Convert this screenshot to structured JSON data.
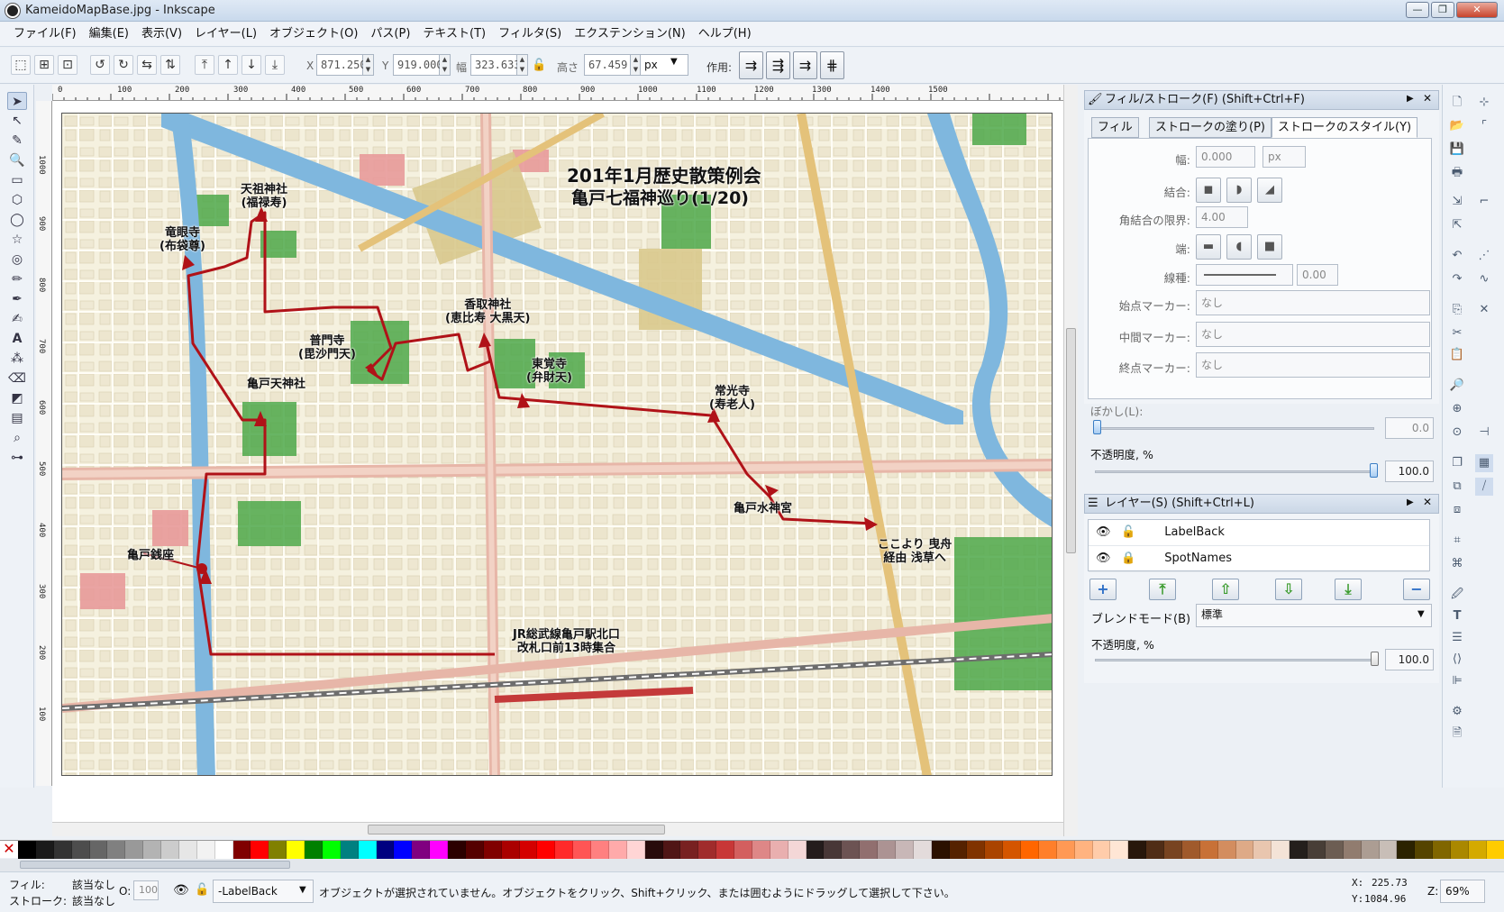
{
  "window": {
    "title": "KameidoMapBase.jpg - Inkscape",
    "minimize": "—",
    "maximize": "❐",
    "close": "✕"
  },
  "menu": [
    "ファイル(F)",
    "編集(E)",
    "表示(V)",
    "レイヤー(L)",
    "オブジェクト(O)",
    "パス(P)",
    "テキスト(T)",
    "フィルタ(S)",
    "エクステンション(N)",
    "ヘルプ(H)"
  ],
  "toolbar": {
    "x_label": "X",
    "x_value": "871.250",
    "y_label": "Y",
    "y_value": "919.000",
    "w_label": "幅",
    "w_value": "323.633",
    "h_label": "高さ",
    "h_value": "67.459",
    "unit": "px",
    "affect_label": "作用:"
  },
  "ruler": {
    "h_labels": [
      "0",
      "100",
      "200",
      "300",
      "400",
      "500",
      "600",
      "700",
      "800",
      "900",
      "1000",
      "1100",
      "1200",
      "1300",
      "1400",
      "1500"
    ],
    "v_labels": [
      "1000",
      "900",
      "800",
      "700",
      "600",
      "500",
      "400",
      "300",
      "200",
      "100"
    ]
  },
  "map": {
    "title_line1": "201年1月歴史散策例会",
    "title_line2": "亀戸七福神巡り(1/20)",
    "spots": [
      {
        "name": "天祖神社\n(福禄寿)"
      },
      {
        "name": "竜眼寺\n(布袋尊)"
      },
      {
        "name": "普門寺\n(毘沙門天)"
      },
      {
        "name": "香取神社\n(恵比寿 大黒天)"
      },
      {
        "name": "東覚寺\n(弁財天)"
      },
      {
        "name": "常光寺\n(寿老人)"
      },
      {
        "name": "亀戸天神社"
      },
      {
        "name": "亀戸水神宮"
      },
      {
        "name": "亀戸銭座"
      },
      {
        "name": "ここより 曳舟\n経由 浅草へ"
      },
      {
        "name": "JR総武線亀戸駅北口\n改札口前13時集合"
      }
    ],
    "route_color": "#b01218"
  },
  "fill_stroke": {
    "header": "フィル/ストローク(F) (Shift+Ctrl+F)",
    "tabs": [
      "フィル",
      "ストロークの塗り(P)",
      "ストロークのスタイル(Y)"
    ],
    "width_label": "幅:",
    "width_value": "0.000",
    "width_unit": "px",
    "join_label": "結合:",
    "miter_label": "角結合の限界:",
    "miter_value": "4.00",
    "cap_label": "端:",
    "dash_label": "線種:",
    "dash_value": "0.00",
    "start_marker_label": "始点マーカー:",
    "start_marker_value": "なし",
    "mid_marker_label": "中間マーカー:",
    "mid_marker_value": "なし",
    "end_marker_label": "終点マーカー:",
    "end_marker_value": "なし",
    "blur_label": "ぼかし(L):",
    "blur_value": "0.0",
    "opacity_label": "不透明度, %",
    "opacity_value": "100.0"
  },
  "layers": {
    "header": "レイヤー(S) (Shift+Ctrl+L)",
    "items": [
      {
        "name": "LabelBack"
      },
      {
        "name": "SpotNames"
      }
    ],
    "blend_label": "ブレンドモード(B)",
    "blend_value": "標準",
    "opacity_label": "不透明度, %",
    "opacity_value": "100.0"
  },
  "palette": [
    "#000000",
    "#1a1a1a",
    "#333333",
    "#4d4d4d",
    "#666666",
    "#808080",
    "#999999",
    "#b3b3b3",
    "#cccccc",
    "#e6e6e6",
    "#f2f2f2",
    "#ffffff",
    "#800000",
    "#ff0000",
    "#808000",
    "#ffff00",
    "#008000",
    "#00ff00",
    "#008080",
    "#00ffff",
    "#000080",
    "#0000ff",
    "#800080",
    "#ff00ff",
    "#2b0000",
    "#550000",
    "#800000",
    "#aa0000",
    "#d40000",
    "#ff0000",
    "#ff2a2a",
    "#ff5555",
    "#ff8080",
    "#ffaaaa",
    "#ffd5d5",
    "#280b0b",
    "#501616",
    "#782121",
    "#a02c2c",
    "#c83737",
    "#d35f5f",
    "#de8787",
    "#e9afaf",
    "#f4d7d7",
    "#241c1c",
    "#483737",
    "#6c5353",
    "#916f6f",
    "#ac9393",
    "#c8b7b7",
    "#e3dbdb",
    "#2b1100",
    "#552200",
    "#803300",
    "#aa4400",
    "#d45500",
    "#ff6600",
    "#ff7f2a",
    "#ff9955",
    "#ffb380",
    "#ffccaa",
    "#ffe6d5",
    "#28170b",
    "#502d16",
    "#784421",
    "#a05a2c",
    "#c87137",
    "#d38d5f",
    "#deaa87",
    "#e9c6af",
    "#f4e3d7",
    "#241f1c",
    "#483e37",
    "#6c5d53",
    "#917c6f",
    "#ac9d93",
    "#c8beb7",
    "#2b2200",
    "#554400",
    "#806600",
    "#aa8800",
    "#d4aa00",
    "#ffcc00"
  ],
  "status": {
    "fill_label": "フィル:",
    "fill_value": "該当なし",
    "stroke_label": "ストローク:",
    "stroke_value": "該当なし",
    "o_label": "O:",
    "o_value": "100",
    "layer_value": "-LabelBack",
    "message": "オブジェクトが選択されていません。オブジェクトをクリック、Shift+クリック、または囲むようにドラッグして選択して下さい。",
    "x_label": "X:",
    "x_value": "225.73",
    "y_label": "Y:",
    "y_value": "1084.96",
    "zoom_label": "Z:",
    "zoom_value": "69%"
  }
}
